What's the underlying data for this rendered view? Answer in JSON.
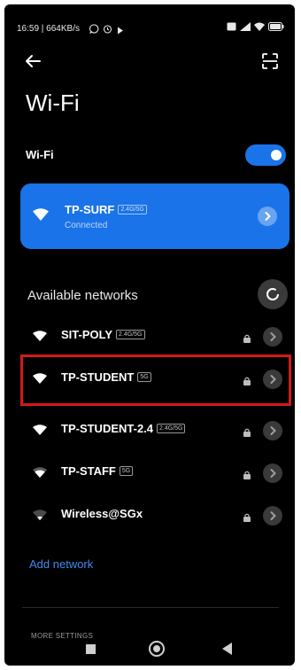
{
  "status_bar": {
    "left_text": "16:59 | 664KB/s",
    "icons": [
      "whatsapp-icon",
      "alarm-icon",
      "play-icon",
      "sim-icon",
      "signal-icon",
      "wifi-icon",
      "battery-icon"
    ]
  },
  "header": {
    "title": "Wi-Fi",
    "back_icon": "arrow-left-icon",
    "scan_icon": "qr-scan-icon"
  },
  "wifi_toggle": {
    "label": "Wi-Fi",
    "enabled": true
  },
  "connected": {
    "ssid": "TP-SURF",
    "band": "2.4G/5G",
    "status": "Connected"
  },
  "available": {
    "title": "Available networks",
    "networks": [
      {
        "ssid": "SIT-POLY",
        "band": "2.4G/5G",
        "secured": true,
        "signal": 4
      },
      {
        "ssid": "TP-STUDENT",
        "band": "5G",
        "secured": true,
        "signal": 4,
        "highlighted": true
      },
      {
        "ssid": "TP-STUDENT-2.4",
        "band": "2.4G/5G",
        "secured": true,
        "signal": 4
      },
      {
        "ssid": "TP-STAFF",
        "band": "5G",
        "secured": true,
        "signal": 3
      },
      {
        "ssid": "Wireless@SGx",
        "band": "",
        "secured": true,
        "signal": 1
      }
    ]
  },
  "add_network_label": "Add network",
  "more_settings_label": "MORE SETTINGS",
  "colors": {
    "accent": "#1a73e8",
    "highlight": "#d3191a",
    "link": "#3d8bf2",
    "background": "#000000"
  }
}
